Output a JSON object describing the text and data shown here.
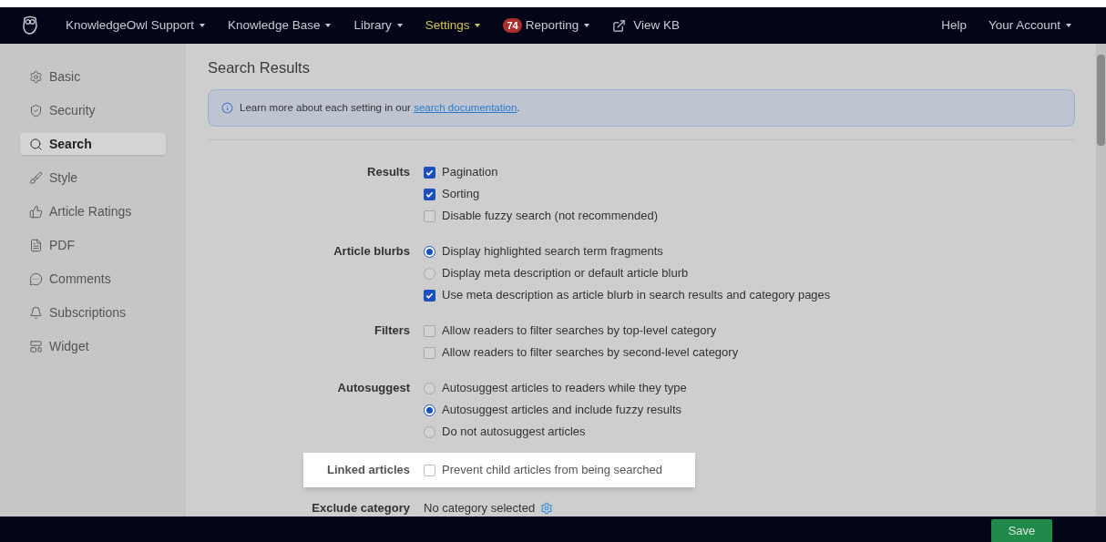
{
  "nav": {
    "items": [
      {
        "label": "KnowledgeOwl Support",
        "dropdown": true,
        "selected": false
      },
      {
        "label": "Knowledge Base",
        "dropdown": true,
        "selected": false
      },
      {
        "label": "Library",
        "dropdown": true,
        "selected": false
      },
      {
        "label": "Settings",
        "dropdown": true,
        "selected": true
      },
      {
        "label": "Reporting",
        "dropdown": true,
        "selected": false,
        "badge": "74"
      },
      {
        "label": "View KB",
        "dropdown": false,
        "selected": false,
        "kind": "external"
      }
    ],
    "right": [
      {
        "label": "Help",
        "dropdown": false
      },
      {
        "label": "Your Account",
        "dropdown": true
      }
    ]
  },
  "sidebar": {
    "items": [
      {
        "label": "Basic",
        "selected": false
      },
      {
        "label": "Security",
        "selected": false
      },
      {
        "label": "Search",
        "selected": true
      },
      {
        "label": "Style",
        "selected": false
      },
      {
        "label": "Article Ratings",
        "selected": false
      },
      {
        "label": "PDF",
        "selected": false
      },
      {
        "label": "Comments",
        "selected": false
      },
      {
        "label": "Subscriptions",
        "selected": false
      },
      {
        "label": "Widget",
        "selected": false
      }
    ]
  },
  "page": {
    "title": "Search Results",
    "notice": {
      "text": "Learn more about each setting in our ",
      "link": "search documentation",
      "after": "."
    },
    "settings": [
      {
        "label": "Results",
        "kind": "checkbox",
        "highlighted": false,
        "options": [
          {
            "label": "Pagination",
            "checked": true
          },
          {
            "label": "Sorting",
            "checked": true
          },
          {
            "label": "Disable fuzzy search (not recommended)",
            "checked": false
          }
        ]
      },
      {
        "label": "Article blurbs",
        "kind": "mixed",
        "highlighted": false,
        "options": [
          {
            "label": "Display highlighted search term fragments",
            "kind": "radio",
            "selected": true
          },
          {
            "label": "Display meta description or default article blurb",
            "kind": "radio",
            "selected": false
          },
          {
            "label": "Use meta description as article blurb in search results and category pages",
            "kind": "checkbox",
            "checked": true
          }
        ]
      },
      {
        "label": "Filters",
        "kind": "checkbox",
        "highlighted": false,
        "options": [
          {
            "label": "Allow readers to filter searches by top-level category",
            "checked": false
          },
          {
            "label": "Allow readers to filter searches by second-level category",
            "checked": false
          }
        ]
      },
      {
        "label": "Autosuggest",
        "kind": "radio",
        "highlighted": false,
        "options": [
          {
            "label": "Autosuggest articles to readers while they type",
            "selected": false
          },
          {
            "label": "Autosuggest articles and include fuzzy results",
            "selected": true
          },
          {
            "label": "Do not autosuggest articles",
            "selected": false
          }
        ]
      },
      {
        "label": "Linked articles",
        "kind": "checkbox",
        "highlighted": true,
        "options": [
          {
            "label": "Prevent child articles from being searched",
            "checked": false
          }
        ]
      },
      {
        "label": "Exclude category",
        "kind": "text",
        "highlighted": false,
        "value": "No category selected"
      }
    ]
  },
  "footer": {
    "button": "Save"
  }
}
